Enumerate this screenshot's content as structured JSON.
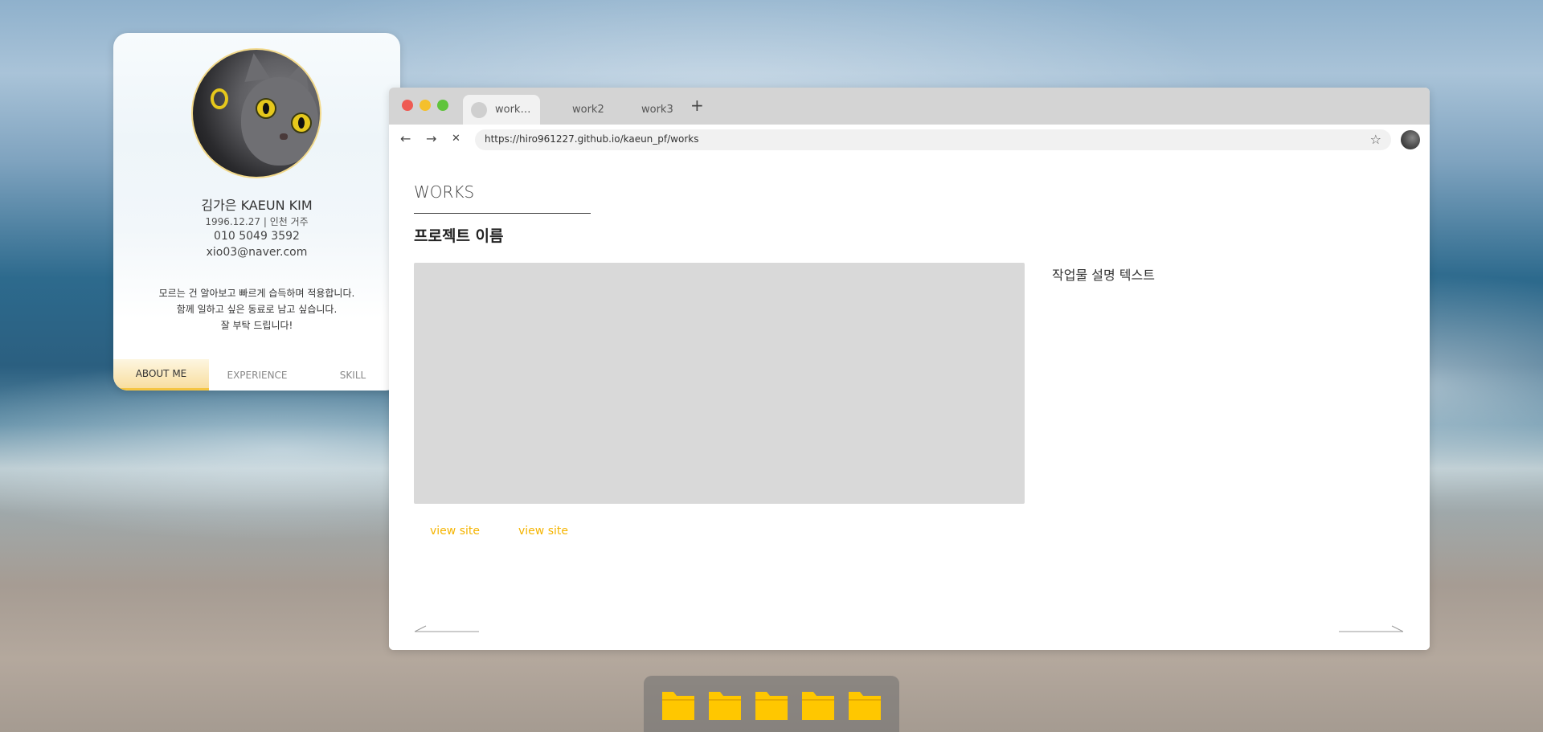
{
  "profile": {
    "name": "김가은 KAEUN KIM",
    "birth_location": "1996.12.27 | 인천 거주",
    "phone": "010 5049 3592",
    "email": "xio03@naver.com",
    "intro": [
      "모르는 건 알아보고 빠르게 습득하며 적용합니다.",
      "함께 일하고 싶은 동료로 남고 싶습니다.",
      "잘 부탁 드립니다!"
    ],
    "tabs": [
      {
        "label": "ABOUT ME",
        "active": true
      },
      {
        "label": "EXPERIENCE",
        "active": false
      },
      {
        "label": "SKILL",
        "active": false
      }
    ]
  },
  "browser": {
    "tabs": [
      {
        "label": "work…",
        "active": true
      },
      {
        "label": "work2",
        "active": false
      },
      {
        "label": "work3",
        "active": false
      }
    ],
    "new_tab_label": "+",
    "nav": {
      "back": "←",
      "forward": "→",
      "stop": "✕"
    },
    "url": "https://hiro961227.github.io/kaeun_pf/works",
    "bookmark_icon": "☆",
    "traffic_lights": {
      "close": "#ee5a52",
      "minimize": "#f5c02c",
      "maximize": "#5fc43b"
    }
  },
  "page": {
    "section_title": "WORKS",
    "project_name": "프로젝트 이름",
    "description": "작업물 설명 텍스트",
    "links": [
      "view site",
      "view site"
    ]
  },
  "dock": {
    "items": [
      "folder-icon",
      "folder-icon",
      "folder-icon",
      "folder-icon",
      "folder-icon"
    ],
    "folder_color": "#ffc700"
  },
  "colors": {
    "accent": "#f5b400",
    "profile_tab_active": "#f8dea0"
  }
}
